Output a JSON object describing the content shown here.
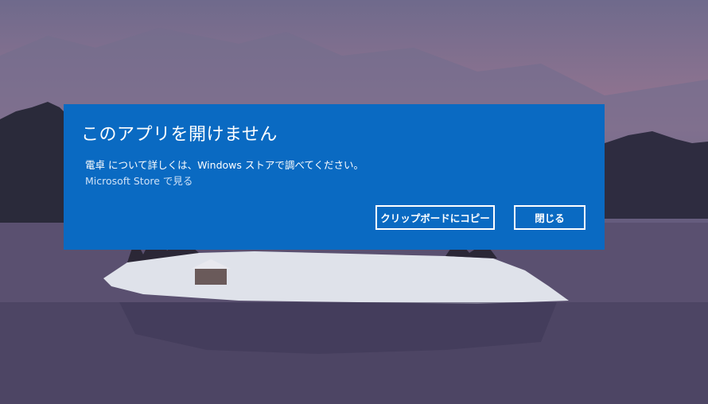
{
  "dialog": {
    "title": "このアプリを開けません",
    "message": "電卓 について詳しくは、Windows ストアで調べてください。",
    "store_link": "Microsoft Store で見る",
    "copy_button": "クリップボードにコピー",
    "close_button": "閉じる"
  },
  "colors": {
    "dialog_background": "#0a6ac2",
    "text": "#ffffff"
  }
}
